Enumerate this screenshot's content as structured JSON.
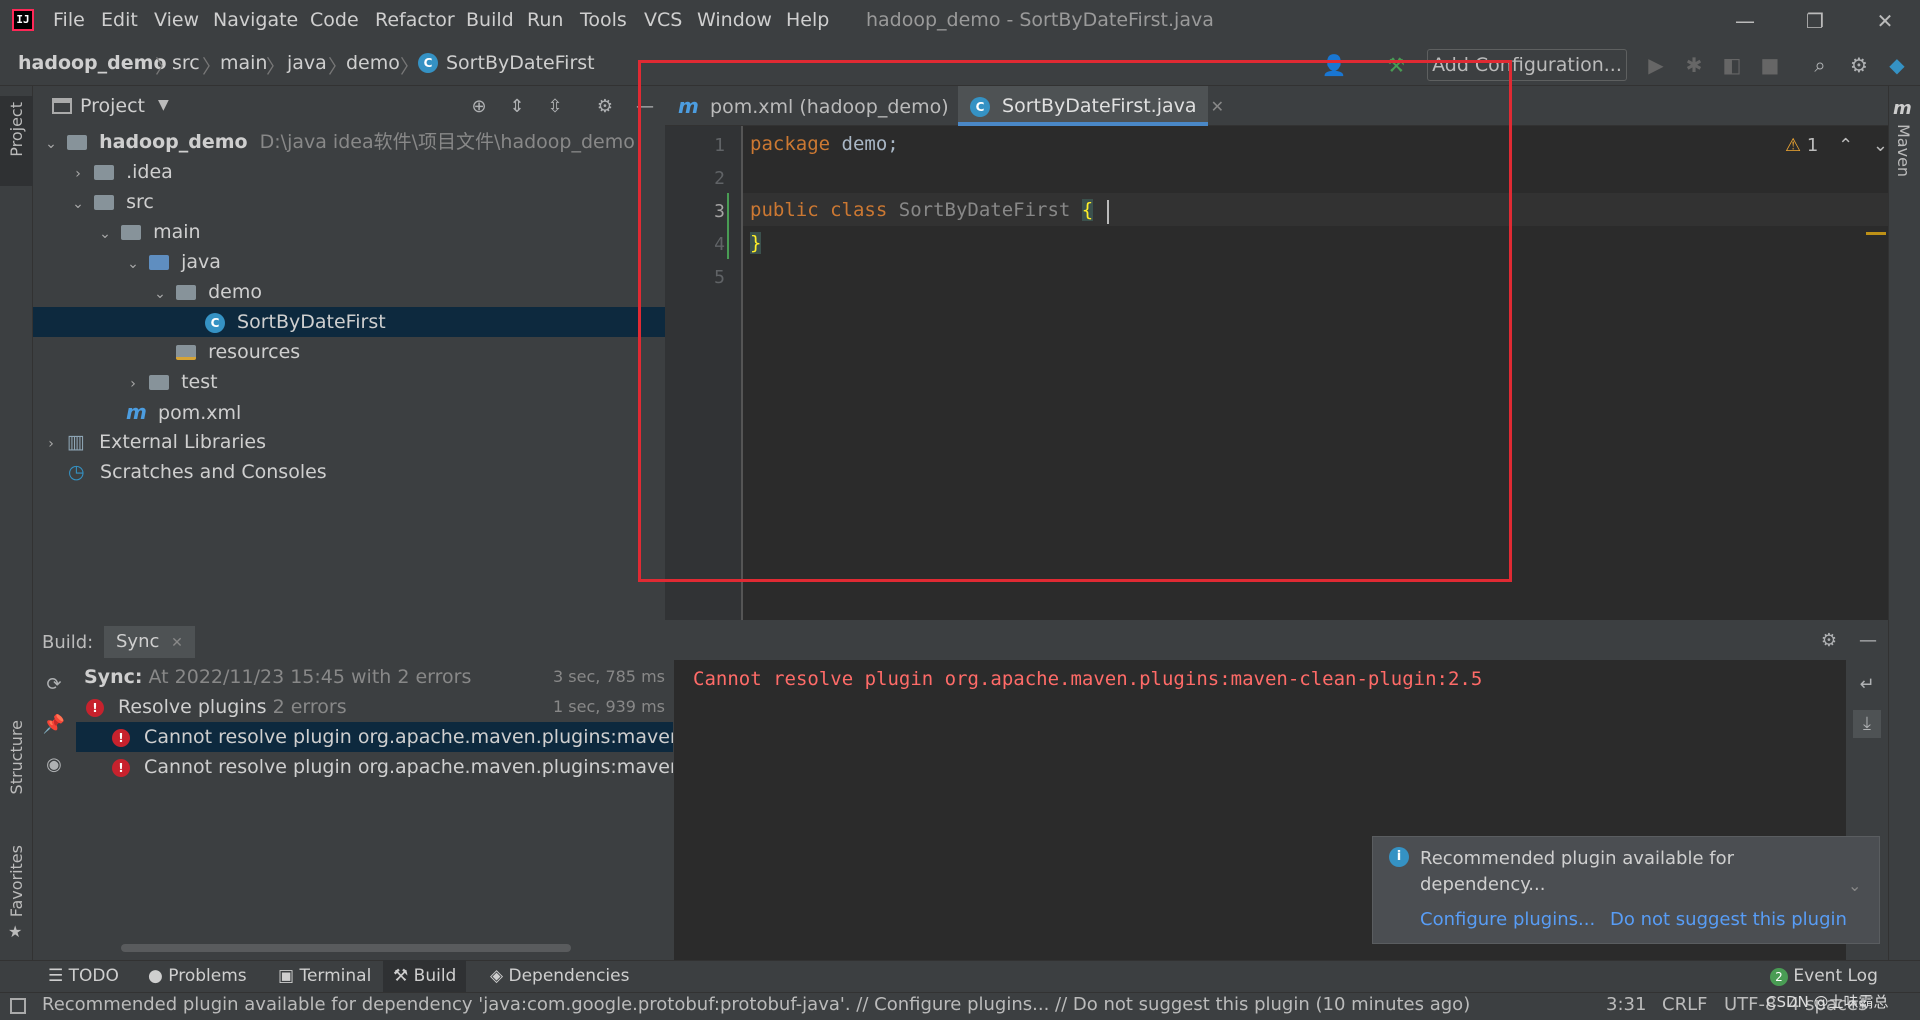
{
  "titlebar": {
    "app_logo": "IJ",
    "menu": [
      "File",
      "Edit",
      "View",
      "Navigate",
      "Code",
      "Refactor",
      "Build",
      "Run",
      "Tools",
      "VCS",
      "Window",
      "Help"
    ],
    "window_title": "hadoop_demo - SortByDateFirst.java",
    "minimize": "—",
    "restore": "❐",
    "close": "✕"
  },
  "breadcrumb": [
    "hadoop_demo",
    "src",
    "main",
    "java",
    "demo",
    "SortByDateFirst"
  ],
  "toolbar": {
    "add_configuration": "Add Configuration..."
  },
  "left_stripe": {
    "project": "Project",
    "structure": "Structure",
    "favorites": "Favorites"
  },
  "right_stripe": {
    "maven": "Maven"
  },
  "project_panel": {
    "title": "Project",
    "tree": [
      {
        "label": "hadoop_demo",
        "path": "D:\\java idea软件\\项目文件\\hadoop_demo",
        "level": 0,
        "expanded": true,
        "kind": "module"
      },
      {
        "label": ".idea",
        "level": 1,
        "expanded": false,
        "kind": "folder"
      },
      {
        "label": "src",
        "level": 1,
        "expanded": true,
        "kind": "folder"
      },
      {
        "label": "main",
        "level": 2,
        "expanded": true,
        "kind": "folder"
      },
      {
        "label": "java",
        "level": 3,
        "expanded": true,
        "kind": "source-folder"
      },
      {
        "label": "demo",
        "level": 4,
        "expanded": true,
        "kind": "package"
      },
      {
        "label": "SortByDateFirst",
        "level": 5,
        "kind": "class",
        "selected": true
      },
      {
        "label": "resources",
        "level": 4,
        "kind": "resource-folder"
      },
      {
        "label": "test",
        "level": 3,
        "expanded": false,
        "kind": "folder"
      },
      {
        "label": "pom.xml",
        "level": 2,
        "kind": "maven"
      },
      {
        "label": "External Libraries",
        "level": 0,
        "expanded": false,
        "kind": "libraries"
      },
      {
        "label": "Scratches and Consoles",
        "level": 0,
        "kind": "scratches"
      }
    ]
  },
  "editor": {
    "tabs": [
      {
        "label": "pom.xml (hadoop_demo)",
        "active": false
      },
      {
        "label": "SortByDateFirst.java",
        "active": true
      }
    ],
    "line_numbers": [
      "1",
      "2",
      "3",
      "4",
      "5"
    ],
    "code": {
      "line1_kw": "package",
      "line1_rest": " demo;",
      "line3_kw1": "public",
      "line3_kw2": "class",
      "line3_name": "SortByDateFirst",
      "line3_brace": "{",
      "line4_brace": "}"
    },
    "warning_count": "1",
    "caret_position": "3:31"
  },
  "build_panel": {
    "title": "Build:",
    "tab": "Sync",
    "rows": [
      {
        "label": "Sync:",
        "detail": "At 2022/11/23 15:45 with 2 errors",
        "time": "3 sec, 785 ms"
      },
      {
        "label": "Resolve plugins",
        "detail": "2 errors",
        "time": "1 sec, 939 ms"
      },
      {
        "label": "Cannot resolve plugin org.apache.maven.plugins:maven-clean-",
        "selected": true
      },
      {
        "label": "Cannot resolve plugin org.apache.maven.plugins:maven-resou"
      }
    ],
    "console_text": "Cannot resolve plugin org.apache.maven.plugins:maven-clean-plugin:2.5"
  },
  "notification": {
    "text": "Recommended plugin available for dependency...",
    "action1": "Configure plugins...",
    "action2": "Do not suggest this plugin"
  },
  "bottom_tabs": [
    "TODO",
    "Problems",
    "Terminal",
    "Build",
    "Dependencies"
  ],
  "event_log": {
    "count": "2",
    "label": "Event Log"
  },
  "statusbar": {
    "message": "Recommended plugin available for dependency 'java:com.google.protobuf:protobuf-java'. // Configure plugins... // Do not suggest this plugin (10 minutes ago)",
    "position": "3:31",
    "line_sep": "CRLF",
    "encoding": "UTF-8",
    "indent": "4 spaces",
    "watermark": "CSDN @土味霸总"
  },
  "colors": {
    "accent": "#4a88c7",
    "error": "#c7222d",
    "highlight_box": "#e02a33",
    "link": "#589df6"
  }
}
